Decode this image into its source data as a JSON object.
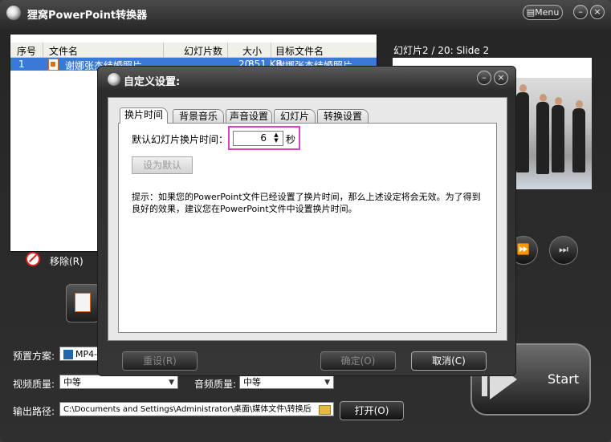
{
  "app": {
    "title": "狸窝PowerPoint转换器",
    "menu_label": "Menu",
    "minimize": "–",
    "close": "×"
  },
  "file_table": {
    "columns": [
      "序号",
      "文件名",
      "幻灯片数",
      "大小",
      "目标文件名"
    ],
    "rows": [
      {
        "index": "1",
        "name": "谢娜张杰结婚照片",
        "slides": "20",
        "size": "851 KB",
        "target": "谢娜张杰结婚照片"
      }
    ]
  },
  "remove_label": "移除(R)",
  "preview": {
    "title": "幻灯片2 / 20: Slide 2"
  },
  "bottom": {
    "preset_label": "预置方案:",
    "preset_value": "MP4-",
    "video_quality_label": "视频质量:",
    "video_quality_value": "中等",
    "audio_quality_label": "音频质量:",
    "audio_quality_value": "中等",
    "output_label": "输出路径:",
    "output_path": "C:\\Documents and Settings\\Administrator\\桌面\\媒体文件\\转换后",
    "open_label": "打开(O)",
    "start_label": "Start"
  },
  "dialog": {
    "title": "自定义设置:",
    "tabs": [
      "换片时间",
      "背景音乐",
      "声音设置",
      "幻灯片",
      "转换设置"
    ],
    "active_tab": "换片时间",
    "field_label": "默认幻灯片换片时间：",
    "interval_value": "6",
    "interval_unit": "秒",
    "set_default_label": "设为默认",
    "hint": "提示：如果您的PowerPoint文件已经设置了换片时间，那么上述设定将会无效。为了得到良好的效果，建议您在PowerPoint文件中设置换片时间。",
    "reset_label": "重设(R)",
    "ok_label": "确定(O)",
    "cancel_label": "取消(C)"
  },
  "colors": {
    "highlight": "#e040c0",
    "selection": "#3a79d6"
  }
}
